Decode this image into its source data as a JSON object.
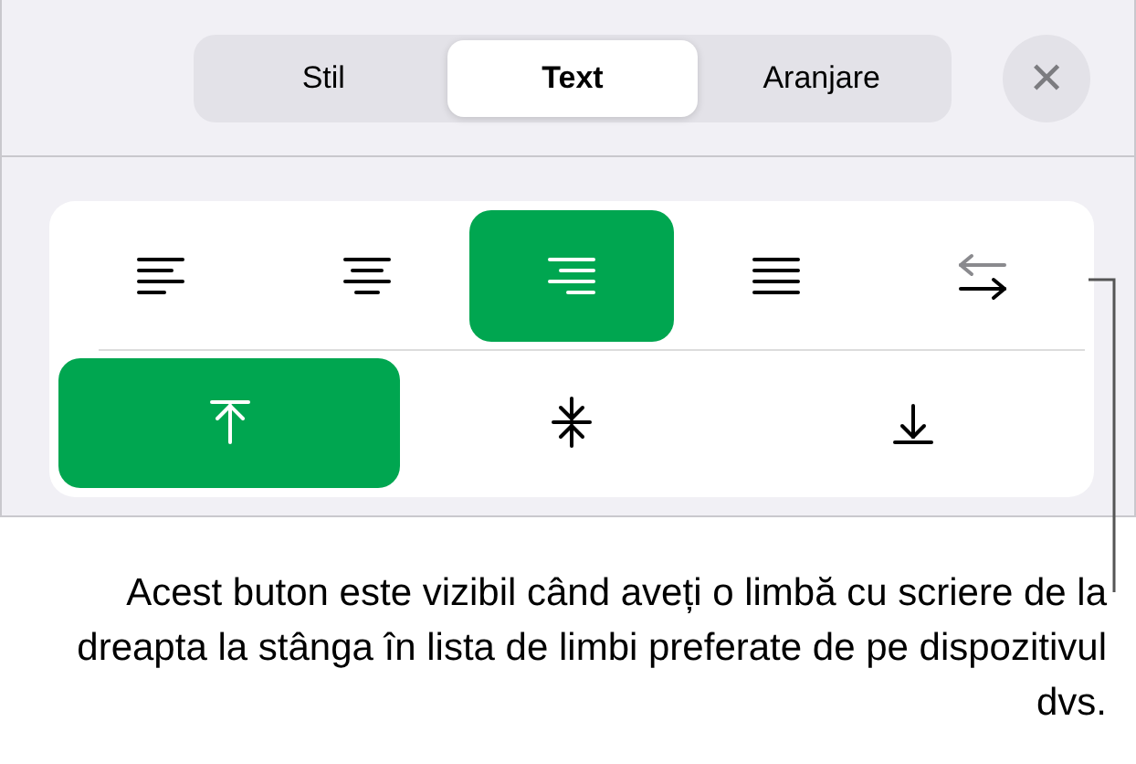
{
  "tabs": [
    {
      "label": "Stil",
      "selected": false
    },
    {
      "label": "Text",
      "selected": true
    },
    {
      "label": "Aranjare",
      "selected": false
    }
  ],
  "close_button": {
    "label": "✕"
  },
  "alignment_buttons": [
    {
      "kind": "left",
      "selected": false
    },
    {
      "kind": "center",
      "selected": false
    },
    {
      "kind": "right",
      "selected": true
    },
    {
      "kind": "justify",
      "selected": false
    },
    {
      "kind": "rtl",
      "selected": false
    }
  ],
  "vertical_buttons": [
    {
      "kind": "top",
      "selected": true
    },
    {
      "kind": "middle",
      "selected": false
    },
    {
      "kind": "bottom",
      "selected": false
    }
  ],
  "callout": "Acest buton este vizibil când aveți o limbă cu scriere de la dreapta la stânga în lista de limbi preferate de pe dispozitivul dvs."
}
